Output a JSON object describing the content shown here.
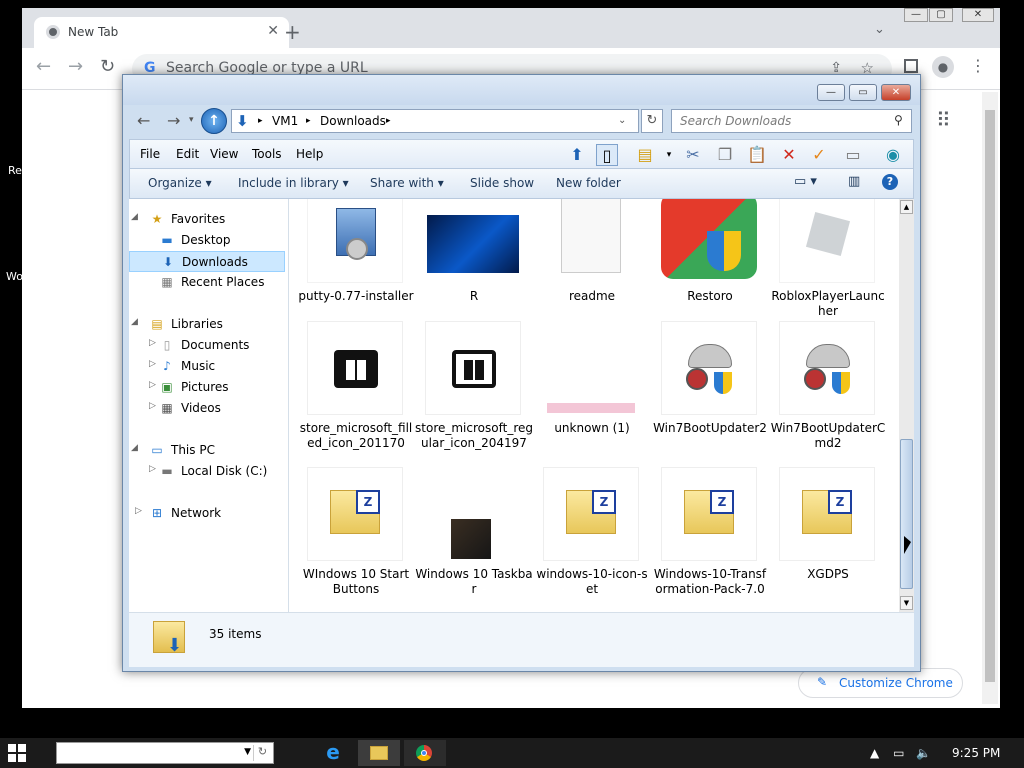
{
  "desktop": {
    "left_text_1": "Re",
    "left_text_2": "Wo"
  },
  "chrome": {
    "tab_title": "New Tab",
    "omnibox_placeholder": "Search Google or type a URL",
    "customize_label": "Customize Chrome"
  },
  "explorer": {
    "breadcrumb": [
      "VM1",
      "Downloads"
    ],
    "search_placeholder": "Search Downloads",
    "menu": [
      "File",
      "Edit",
      "View",
      "Tools",
      "Help"
    ],
    "commands": [
      "Organize",
      "Include in library",
      "Share with",
      "Slide show",
      "New folder"
    ],
    "nav": {
      "favorites": "Favorites",
      "desktop": "Desktop",
      "downloads": "Downloads",
      "recent": "Recent Places",
      "libraries": "Libraries",
      "documents": "Documents",
      "music": "Music",
      "pictures": "Pictures",
      "videos": "Videos",
      "thispc": "This PC",
      "localdisk": "Local Disk (C:)",
      "network": "Network"
    },
    "files": [
      {
        "name": "putty-0.77-installer",
        "kind": "installer"
      },
      {
        "name": "R",
        "kind": "windows-wallpaper"
      },
      {
        "name": "readme",
        "kind": "text-doc"
      },
      {
        "name": "Restoro",
        "kind": "restoro-app"
      },
      {
        "name": "RobloxPlayerLauncher",
        "kind": "roblox"
      },
      {
        "name": "store_microsoft_filled_icon_201170",
        "kind": "store-filled"
      },
      {
        "name": "store_microsoft_regular_icon_204197",
        "kind": "store-regular"
      },
      {
        "name": "unknown (1)",
        "kind": "small-image"
      },
      {
        "name": "Win7BootUpdater2",
        "kind": "boot-updater"
      },
      {
        "name": "Win7BootUpdaterCmd2",
        "kind": "boot-updater"
      },
      {
        "name": "WIndows 10 Start Buttons",
        "kind": "zip-folder"
      },
      {
        "name": "Windows 10 Taskbar",
        "kind": "dark-image"
      },
      {
        "name": "windows-10-icon-set",
        "kind": "zip-folder"
      },
      {
        "name": "Windows-10-Transformation-Pack-7.0",
        "kind": "zip-folder"
      },
      {
        "name": "XGDPS",
        "kind": "zip-folder"
      }
    ],
    "item_count": "35 items"
  },
  "taskbar": {
    "time": "9:25 PM"
  },
  "colors": {
    "explorer_frame": "#cfdff0",
    "selection": "#cce8ff",
    "link_blue": "#1a73e8"
  }
}
